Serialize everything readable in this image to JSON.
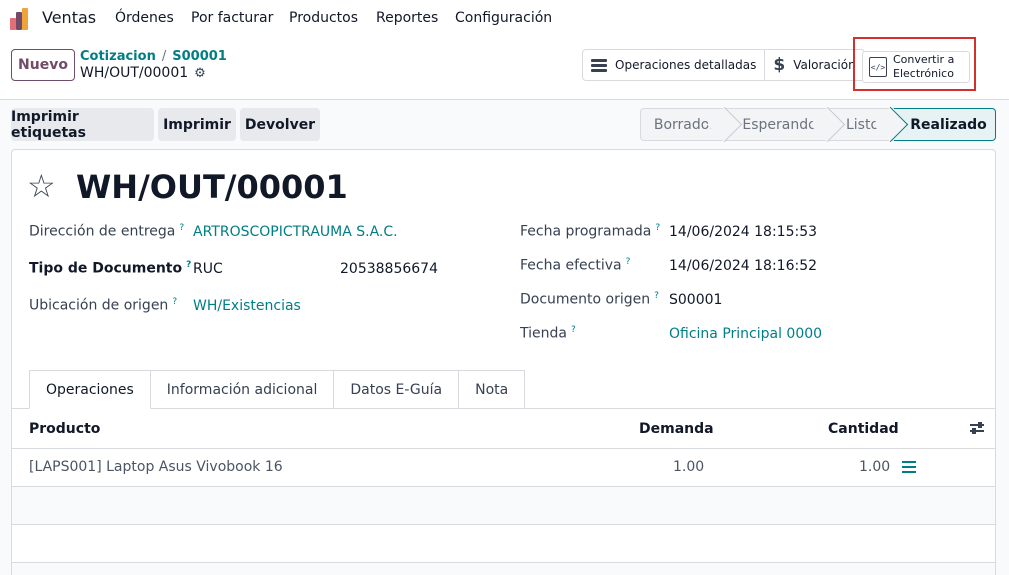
{
  "app": {
    "name": "Ventas"
  },
  "menu": [
    "Órdenes",
    "Por facturar",
    "Productos",
    "Reportes",
    "Configuración"
  ],
  "control_panel": {
    "new_label": "Nuevo",
    "breadcrumb": [
      "Cotizacion",
      "S00001"
    ],
    "current": "WH/OUT/00001",
    "actions": {
      "detailed_ops": "Operaciones detalladas",
      "valuation": "Valoración",
      "convert_line1": "Convertir a",
      "convert_line2": "Electrónico"
    }
  },
  "header_buttons": {
    "print_labels": "Imprimir etiquetas",
    "print": "Imprimir",
    "return": "Devolver"
  },
  "statusbar": [
    "Borrador",
    "Esperando",
    "Listo",
    "Realizado"
  ],
  "record": {
    "title": "WH/OUT/00001",
    "left_fields": [
      {
        "label": "Dirección de entrega",
        "value": "ARTROSCOPICTRAUMA S.A.C."
      },
      {
        "label": "Tipo de Documento",
        "value": "RUC",
        "extra": "20538856674"
      },
      {
        "label": "Ubicación de origen",
        "value": "WH/Existencias"
      }
    ],
    "right_fields": [
      {
        "label": "Fecha programada",
        "value": "14/06/2024 18:15:53"
      },
      {
        "label": "Fecha efectiva",
        "value": "14/06/2024 18:16:52"
      },
      {
        "label": "Documento origen",
        "value": "S00001"
      },
      {
        "label": "Tienda",
        "value": "Oficina Principal 0000"
      }
    ],
    "help_mark": "?"
  },
  "tabs": [
    "Operaciones",
    "Información adicional",
    "Datos E-Guía",
    "Nota"
  ],
  "table": {
    "columns": [
      "Producto",
      "Demanda",
      "Cantidad"
    ],
    "rows": [
      {
        "product": "[LAPS001] Laptop Asus Vivobook 16",
        "demand": "1.00",
        "quantity": "1.00"
      }
    ]
  },
  "colors": {
    "brand": "#714b67",
    "link": "#017e84",
    "highlight": "#d32f2f"
  }
}
